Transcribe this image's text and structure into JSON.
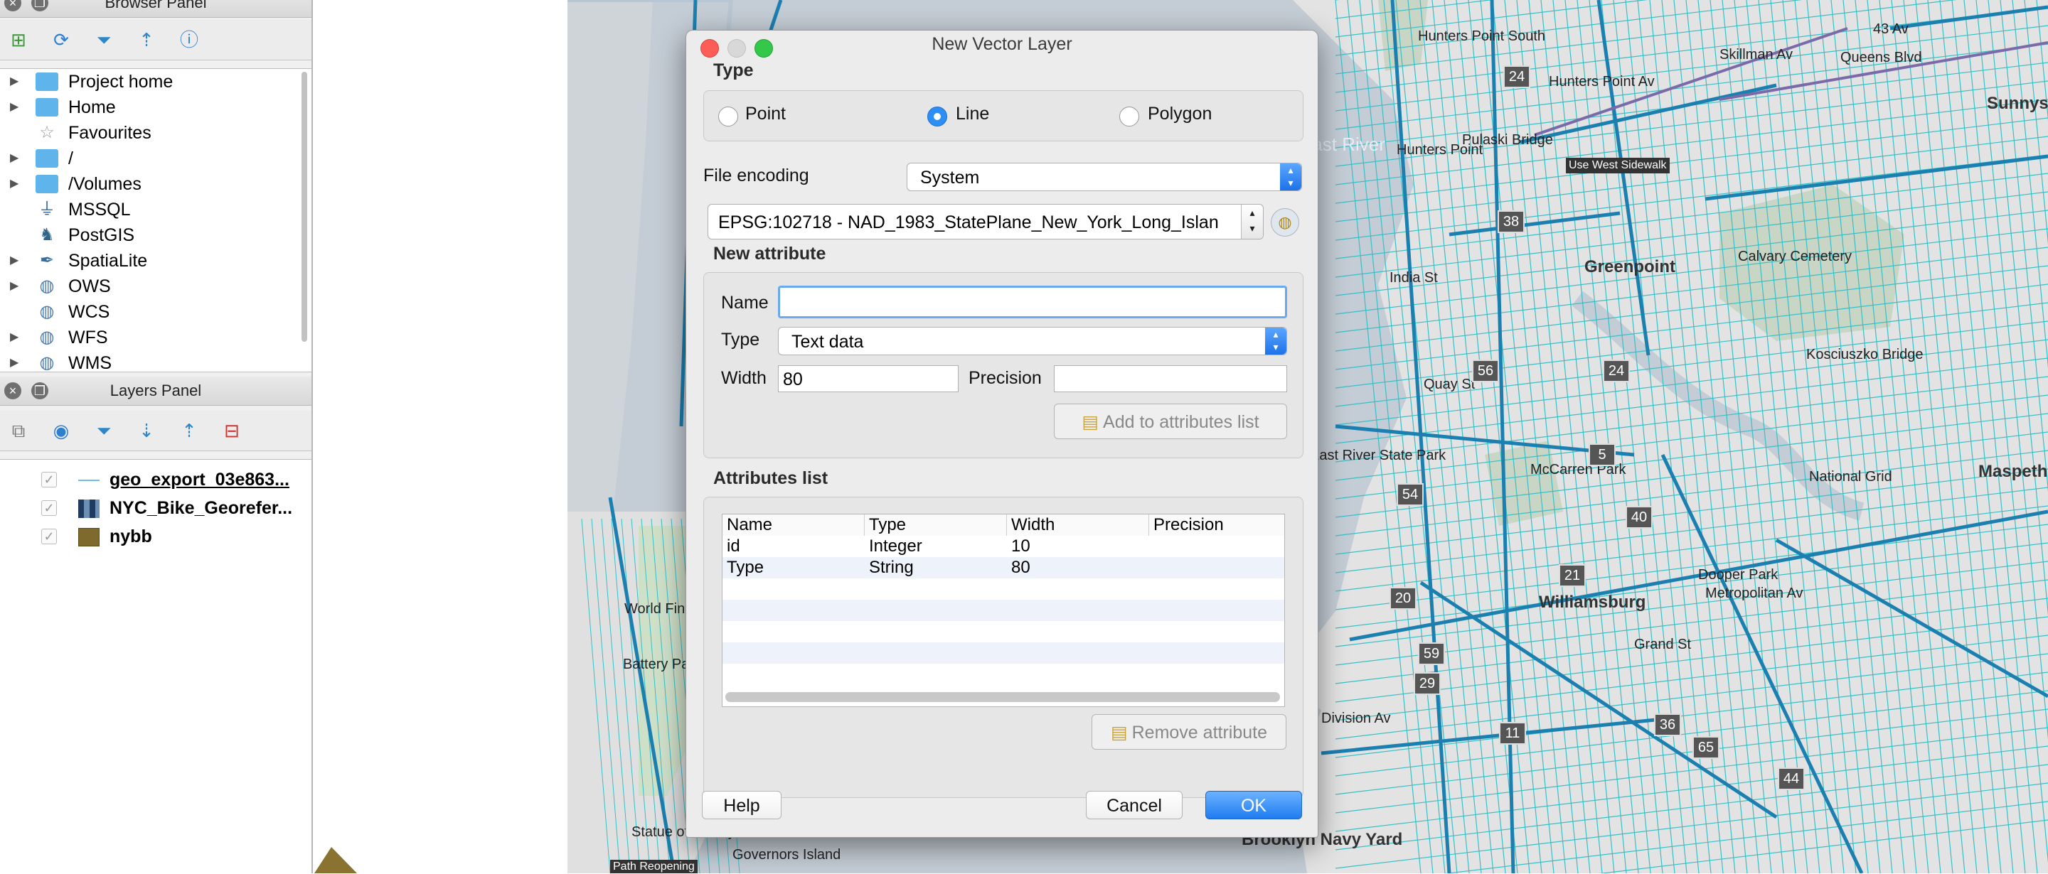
{
  "browser_panel": {
    "title": "Browser Panel",
    "items": [
      {
        "label": "Project home",
        "icon": "folder-icon",
        "expandable": true
      },
      {
        "label": "Home",
        "icon": "folder-icon",
        "expandable": true
      },
      {
        "label": "Favourites",
        "icon": "star-icon",
        "expandable": false
      },
      {
        "label": "/",
        "icon": "folder-icon",
        "expandable": true
      },
      {
        "label": "/Volumes",
        "icon": "folder-icon",
        "expandable": true
      },
      {
        "label": "MSSQL",
        "icon": "mssql-icon",
        "expandable": false
      },
      {
        "label": "PostGIS",
        "icon": "postgis-elephant-icon",
        "expandable": false
      },
      {
        "label": "SpatiaLite",
        "icon": "spatialite-feather-icon",
        "expandable": true
      },
      {
        "label": "OWS",
        "icon": "globe-icon",
        "expandable": true
      },
      {
        "label": "WCS",
        "icon": "globe-icon",
        "expandable": false
      },
      {
        "label": "WFS",
        "icon": "globe-icon",
        "expandable": true
      },
      {
        "label": "WMS",
        "icon": "globe-icon",
        "expandable": true
      }
    ]
  },
  "layers_panel": {
    "title": "Layers Panel",
    "layers": [
      {
        "label": "geo_export_03e863...",
        "checked": true,
        "symbol": "line"
      },
      {
        "label": "NYC_Bike_Georefer...",
        "checked": true,
        "symbol": "raster"
      },
      {
        "label": "nybb",
        "checked": true,
        "symbol": "polygon",
        "color": "#7e6a2c"
      }
    ]
  },
  "dialog": {
    "title": "New Vector Layer",
    "type_group": {
      "label": "Type",
      "options": [
        "Point",
        "Line",
        "Polygon"
      ],
      "selected": "Line"
    },
    "file_encoding": {
      "label": "File encoding",
      "value": "System"
    },
    "crs": {
      "value": "EPSG:102718 - NAD_1983_StatePlane_New_York_Long_Islan"
    },
    "new_attribute": {
      "label": "New attribute",
      "name_label": "Name",
      "name_value": "",
      "type_label": "Type",
      "type_value": "Text data",
      "width_label": "Width",
      "width_value": "80",
      "precision_label": "Precision",
      "precision_value": "",
      "add_button": "Add to attributes list"
    },
    "attributes_list": {
      "label": "Attributes list",
      "columns": [
        "Name",
        "Type",
        "Width",
        "Precision"
      ],
      "rows": [
        {
          "name": "id",
          "type": "Integer",
          "width": "10",
          "precision": ""
        },
        {
          "name": "Type",
          "type": "String",
          "width": "80",
          "precision": ""
        }
      ],
      "remove_button": "Remove attribute"
    },
    "buttons": {
      "help": "Help",
      "cancel": "Cancel",
      "ok": "OK"
    }
  },
  "map": {
    "labels": [
      "Hunters Point South",
      "Hunters Point",
      "Hunters Point Av",
      "Greenpoint",
      "Williamsburg",
      "Sunnyside",
      "Calvary Cemetery",
      "Kosciuszko Bridge",
      "National Grid",
      "Maspeth",
      "Battery Park City",
      "Brooklyn Navy Yard",
      "World Financial Center",
      "East River State Park",
      "India St",
      "Pulaski Bridge",
      "Use West Sidewalk",
      "Governors Island",
      "Statue of Liberty",
      "Path Reopening",
      "Grand St",
      "Metropolitan Av",
      "Quay St",
      "Skillman Av",
      "Queens Blvd",
      "43 Av",
      "Division Av",
      "McCarren Park",
      "Dooper Park"
    ],
    "water_labels": [
      "East River"
    ],
    "route_badges": [
      "24",
      "38",
      "24",
      "56",
      "54",
      "5",
      "40",
      "21",
      "20",
      "59",
      "29",
      "11",
      "36",
      "65",
      "44"
    ],
    "colors": {
      "land": "#e2e2e2",
      "water": "#c4ccd5",
      "bike_route": "#35c0c8",
      "bike_lane": "#1b7fb0",
      "park": "#c9d6c6"
    }
  }
}
